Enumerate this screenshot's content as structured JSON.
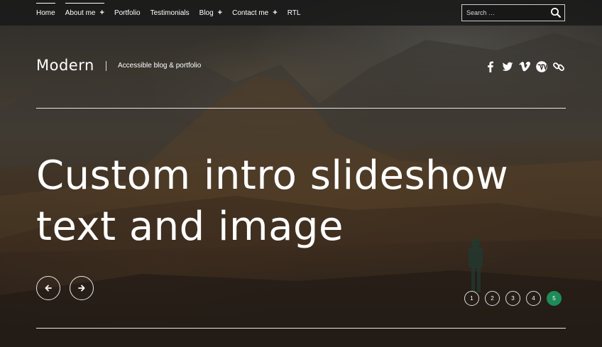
{
  "nav": {
    "items": [
      {
        "label": "Home",
        "has_submenu": false,
        "active": true
      },
      {
        "label": "About me",
        "has_submenu": true,
        "active": false
      },
      {
        "label": "Portfolio",
        "has_submenu": false,
        "active": false
      },
      {
        "label": "Testimonials",
        "has_submenu": false,
        "active": false
      },
      {
        "label": "Blog",
        "has_submenu": true,
        "active": false
      },
      {
        "label": "Contact me",
        "has_submenu": true,
        "active": false
      },
      {
        "label": "RTL",
        "has_submenu": false,
        "active": false
      }
    ],
    "submenu_symbol": "+"
  },
  "search": {
    "placeholder": "Search …",
    "value": "",
    "icon": "search-icon"
  },
  "header": {
    "site_title": "Modern",
    "tagline": "Accessible blog & portfolio",
    "social_icons": [
      "facebook-icon",
      "twitter-icon",
      "vimeo-icon",
      "wordpress-icon",
      "link-icon"
    ]
  },
  "slideshow": {
    "title_line1": "Custom intro slideshow",
    "title_line2": "text and image",
    "prev_icon": "arrow-left-icon",
    "next_icon": "arrow-right-icon",
    "pages": [
      "1",
      "2",
      "3",
      "4",
      "5"
    ],
    "current_page": "5"
  },
  "colors": {
    "accent": "#1f8a5a",
    "topbar": "#191919",
    "text": "#ffffff"
  }
}
